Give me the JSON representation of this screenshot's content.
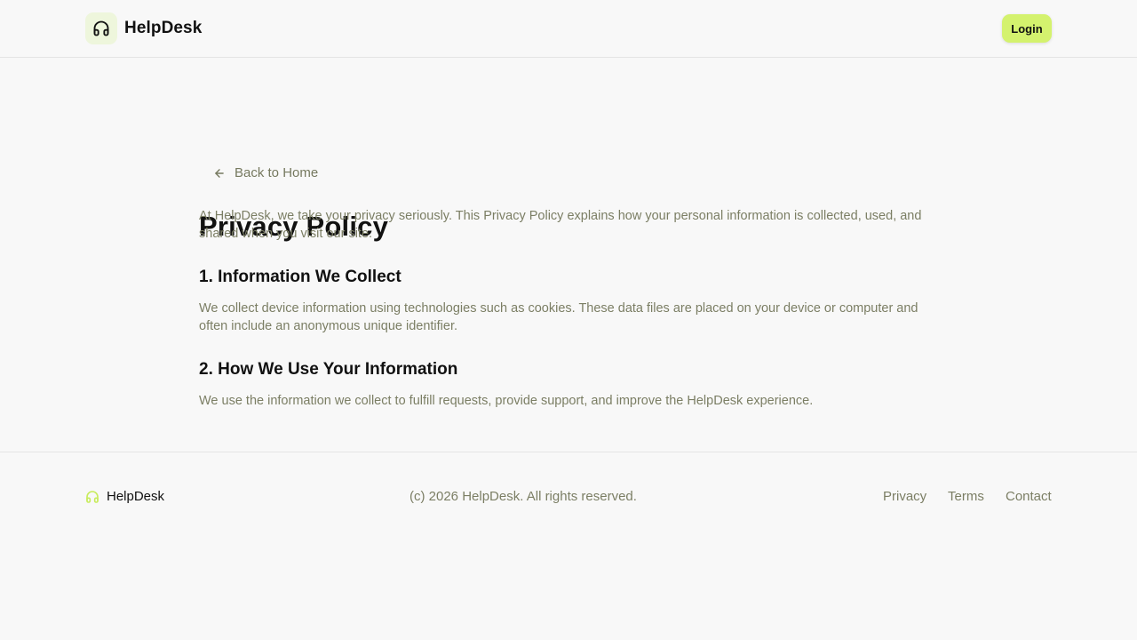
{
  "header": {
    "brand": "HelpDesk",
    "logo_icon": "headphones-icon",
    "login_label": "Login"
  },
  "main": {
    "back_label": "Back to Home",
    "back_icon": "arrow-left-icon",
    "title": "Privacy Policy",
    "intro": "At HelpDesk, we take your privacy seriously. This Privacy Policy explains how your personal information is collected, used, and shared when you visit our site.",
    "sections": [
      {
        "heading": "1. Information We Collect",
        "body": "We collect device information using technologies such as cookies. These data files are placed on your device or computer and often include an anonymous unique identifier."
      },
      {
        "heading": "2. How We Use Your Information",
        "body": "We use the information we collect to fulfill requests, provide support, and improve the HelpDesk experience."
      }
    ]
  },
  "footer": {
    "brand": "HelpDesk",
    "copyright": "(c) 2026 HelpDesk. All rights reserved.",
    "links": [
      "Privacy",
      "Terms",
      "Contact"
    ]
  },
  "colors": {
    "accent": "#d4f26e",
    "logo_bg": "#eef6dc",
    "muted_text": "#7b7e64",
    "background": "#f8f8f8",
    "border": "#e5e5e5"
  }
}
